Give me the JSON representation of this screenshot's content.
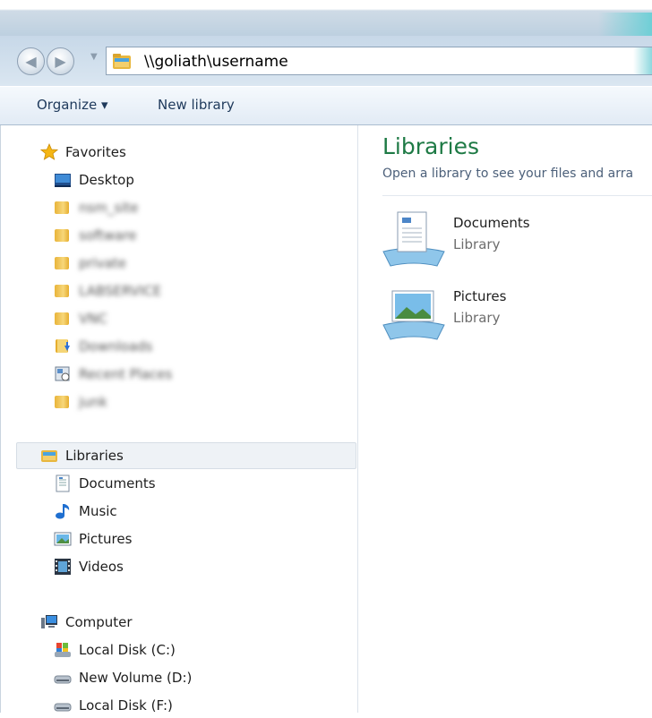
{
  "address": {
    "path": "\\\\goliath\\username"
  },
  "command_bar": {
    "organize": "Organize ▾",
    "new_library": "New library"
  },
  "navigation": {
    "favorites": {
      "label": "Favorites",
      "items": [
        {
          "label": "Desktop",
          "icon": "desktop-icon"
        },
        {
          "label": "nsm_site",
          "icon": "folder-icon"
        },
        {
          "label": "software",
          "icon": "folder-icon"
        },
        {
          "label": "private",
          "icon": "folder-icon"
        },
        {
          "label": "LABSERVICE",
          "icon": "folder-icon"
        },
        {
          "label": "VNC",
          "icon": "folder-icon"
        },
        {
          "label": "Downloads",
          "icon": "downloads-icon"
        },
        {
          "label": "Recent Places",
          "icon": "recent-places-icon"
        },
        {
          "label": "junk",
          "icon": "folder-icon"
        }
      ]
    },
    "libraries": {
      "label": "Libraries",
      "items": [
        {
          "label": "Documents",
          "icon": "documents-icon"
        },
        {
          "label": "Music",
          "icon": "music-icon"
        },
        {
          "label": "Pictures",
          "icon": "pictures-icon"
        },
        {
          "label": "Videos",
          "icon": "videos-icon"
        }
      ]
    },
    "computer": {
      "label": "Computer",
      "items": [
        {
          "label": "Local Disk (C:)",
          "icon": "system-drive-icon"
        },
        {
          "label": "New Volume (D:)",
          "icon": "drive-icon"
        },
        {
          "label": "Local Disk (F:)",
          "icon": "drive-icon"
        }
      ]
    }
  },
  "content": {
    "heading": "Libraries",
    "subtitle": "Open a library to see your files and arra",
    "libraries": [
      {
        "name": "Documents",
        "kind": "Library"
      },
      {
        "name": "Pictures",
        "kind": "Library"
      }
    ]
  },
  "colors": {
    "heading_green": "#1e7a45",
    "command_text": "#1e395b",
    "selection": "#eef2f6"
  }
}
